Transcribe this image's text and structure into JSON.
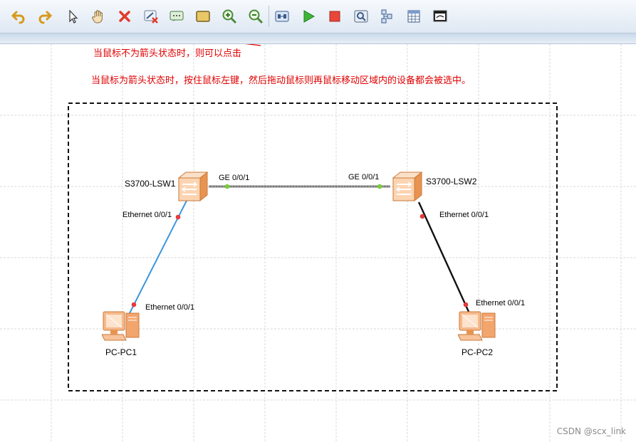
{
  "toolbar": {
    "icons": [
      "undo-icon",
      "redo-icon",
      "pointer-icon",
      "hand-icon",
      "delete-icon",
      "delete-link-icon",
      "text-icon",
      "rectangle-icon",
      "zoom-in-icon",
      "zoom-out-icon",
      "topology-icon",
      "start-icon",
      "stop-icon",
      "capture-icon",
      "device-list-icon",
      "table-icon",
      "console-icon"
    ]
  },
  "annotations": {
    "line1": "当鼠标不为箭头状态时，则可以点击",
    "line2": "当鼠标为箭头状态时，按住鼠标左键，然后拖动鼠标则再鼠标移动区域内的设备都会被选中。"
  },
  "devices": {
    "lsw1": {
      "name": "S3700-LSW1",
      "port_ge": "GE 0/0/1",
      "port_eth": "Ethernet 0/0/1"
    },
    "lsw2": {
      "name": "S3700-LSW2",
      "port_ge": "GE 0/0/1",
      "port_eth": "Ethernet 0/0/1"
    },
    "pc1": {
      "name": "PC-PC1",
      "port": "Ethernet 0/0/1"
    },
    "pc2": {
      "name": "PC-PC2",
      "port": "Ethernet 0/0/1"
    }
  },
  "watermark": "CSDN @scx_link",
  "colors": {
    "annotation": "#e00000",
    "link_pc1": "#3a96dd",
    "link_pc2": "#111111",
    "link_ge": "#666666",
    "port_up": "#7ccc3a",
    "port_down": "#e53b3b"
  }
}
